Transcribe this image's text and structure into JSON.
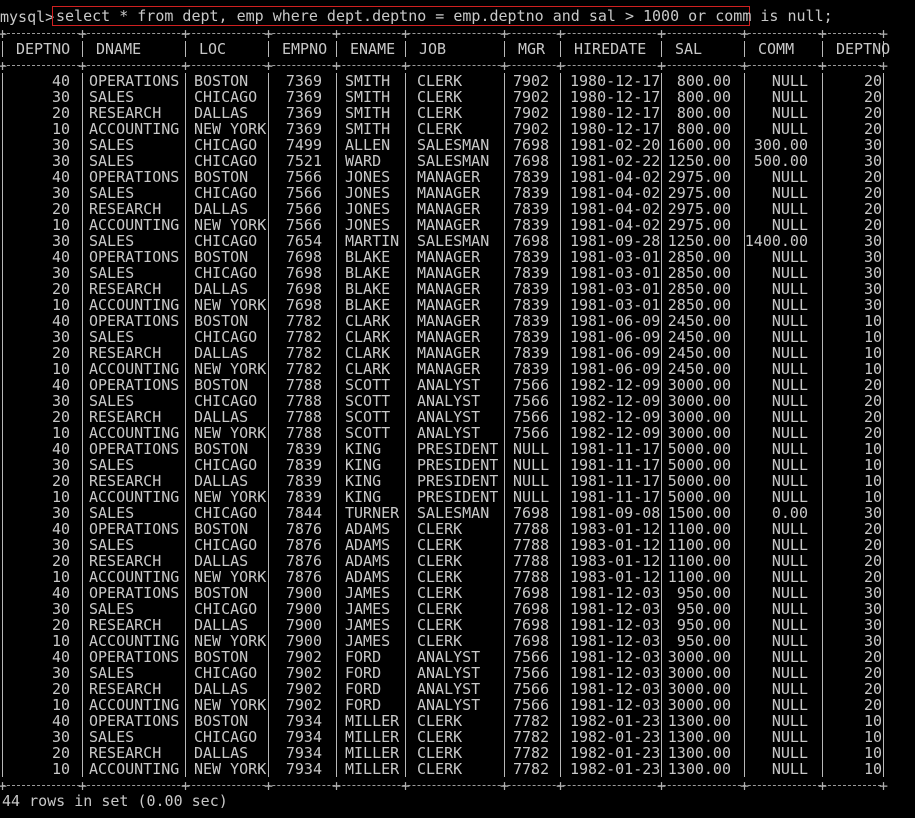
{
  "terminal": {
    "prompt": "mysql>",
    "query": "select * from dept, emp where dept.deptno = emp.deptno and sal > 1000 or comm is null;",
    "footer": "44 rows in set (0.00 sec)",
    "colors": {
      "background": "#000000",
      "text": "#c8c8c8",
      "highlight_box": "#d02020"
    }
  },
  "columns": [
    "DEPTNO",
    "DNAME",
    "LOC",
    "EMPNO",
    "ENAME",
    "JOB",
    "MGR",
    "HIREDATE",
    "SAL",
    "COMM",
    "DEPTNO"
  ],
  "rows": [
    [
      "40",
      "OPERATIONS",
      "BOSTON",
      "7369",
      "SMITH",
      "CLERK",
      "7902",
      "1980-12-17",
      "800.00",
      "NULL",
      "20"
    ],
    [
      "30",
      "SALES",
      "CHICAGO",
      "7369",
      "SMITH",
      "CLERK",
      "7902",
      "1980-12-17",
      "800.00",
      "NULL",
      "20"
    ],
    [
      "20",
      "RESEARCH",
      "DALLAS",
      "7369",
      "SMITH",
      "CLERK",
      "7902",
      "1980-12-17",
      "800.00",
      "NULL",
      "20"
    ],
    [
      "10",
      "ACCOUNTING",
      "NEW YORK",
      "7369",
      "SMITH",
      "CLERK",
      "7902",
      "1980-12-17",
      "800.00",
      "NULL",
      "20"
    ],
    [
      "30",
      "SALES",
      "CHICAGO",
      "7499",
      "ALLEN",
      "SALESMAN",
      "7698",
      "1981-02-20",
      "1600.00",
      "300.00",
      "30"
    ],
    [
      "30",
      "SALES",
      "CHICAGO",
      "7521",
      "WARD",
      "SALESMAN",
      "7698",
      "1981-02-22",
      "1250.00",
      "500.00",
      "30"
    ],
    [
      "40",
      "OPERATIONS",
      "BOSTON",
      "7566",
      "JONES",
      "MANAGER",
      "7839",
      "1981-04-02",
      "2975.00",
      "NULL",
      "20"
    ],
    [
      "30",
      "SALES",
      "CHICAGO",
      "7566",
      "JONES",
      "MANAGER",
      "7839",
      "1981-04-02",
      "2975.00",
      "NULL",
      "20"
    ],
    [
      "20",
      "RESEARCH",
      "DALLAS",
      "7566",
      "JONES",
      "MANAGER",
      "7839",
      "1981-04-02",
      "2975.00",
      "NULL",
      "20"
    ],
    [
      "10",
      "ACCOUNTING",
      "NEW YORK",
      "7566",
      "JONES",
      "MANAGER",
      "7839",
      "1981-04-02",
      "2975.00",
      "NULL",
      "20"
    ],
    [
      "30",
      "SALES",
      "CHICAGO",
      "7654",
      "MARTIN",
      "SALESMAN",
      "7698",
      "1981-09-28",
      "1250.00",
      "1400.00",
      "30"
    ],
    [
      "40",
      "OPERATIONS",
      "BOSTON",
      "7698",
      "BLAKE",
      "MANAGER",
      "7839",
      "1981-03-01",
      "2850.00",
      "NULL",
      "30"
    ],
    [
      "30",
      "SALES",
      "CHICAGO",
      "7698",
      "BLAKE",
      "MANAGER",
      "7839",
      "1981-03-01",
      "2850.00",
      "NULL",
      "30"
    ],
    [
      "20",
      "RESEARCH",
      "DALLAS",
      "7698",
      "BLAKE",
      "MANAGER",
      "7839",
      "1981-03-01",
      "2850.00",
      "NULL",
      "30"
    ],
    [
      "10",
      "ACCOUNTING",
      "NEW YORK",
      "7698",
      "BLAKE",
      "MANAGER",
      "7839",
      "1981-03-01",
      "2850.00",
      "NULL",
      "30"
    ],
    [
      "40",
      "OPERATIONS",
      "BOSTON",
      "7782",
      "CLARK",
      "MANAGER",
      "7839",
      "1981-06-09",
      "2450.00",
      "NULL",
      "10"
    ],
    [
      "30",
      "SALES",
      "CHICAGO",
      "7782",
      "CLARK",
      "MANAGER",
      "7839",
      "1981-06-09",
      "2450.00",
      "NULL",
      "10"
    ],
    [
      "20",
      "RESEARCH",
      "DALLAS",
      "7782",
      "CLARK",
      "MANAGER",
      "7839",
      "1981-06-09",
      "2450.00",
      "NULL",
      "10"
    ],
    [
      "10",
      "ACCOUNTING",
      "NEW YORK",
      "7782",
      "CLARK",
      "MANAGER",
      "7839",
      "1981-06-09",
      "2450.00",
      "NULL",
      "10"
    ],
    [
      "40",
      "OPERATIONS",
      "BOSTON",
      "7788",
      "SCOTT",
      "ANALYST",
      "7566",
      "1982-12-09",
      "3000.00",
      "NULL",
      "20"
    ],
    [
      "30",
      "SALES",
      "CHICAGO",
      "7788",
      "SCOTT",
      "ANALYST",
      "7566",
      "1982-12-09",
      "3000.00",
      "NULL",
      "20"
    ],
    [
      "20",
      "RESEARCH",
      "DALLAS",
      "7788",
      "SCOTT",
      "ANALYST",
      "7566",
      "1982-12-09",
      "3000.00",
      "NULL",
      "20"
    ],
    [
      "10",
      "ACCOUNTING",
      "NEW YORK",
      "7788",
      "SCOTT",
      "ANALYST",
      "7566",
      "1982-12-09",
      "3000.00",
      "NULL",
      "20"
    ],
    [
      "40",
      "OPERATIONS",
      "BOSTON",
      "7839",
      "KING",
      "PRESIDENT",
      "NULL",
      "1981-11-17",
      "5000.00",
      "NULL",
      "10"
    ],
    [
      "30",
      "SALES",
      "CHICAGO",
      "7839",
      "KING",
      "PRESIDENT",
      "NULL",
      "1981-11-17",
      "5000.00",
      "NULL",
      "10"
    ],
    [
      "20",
      "RESEARCH",
      "DALLAS",
      "7839",
      "KING",
      "PRESIDENT",
      "NULL",
      "1981-11-17",
      "5000.00",
      "NULL",
      "10"
    ],
    [
      "10",
      "ACCOUNTING",
      "NEW YORK",
      "7839",
      "KING",
      "PRESIDENT",
      "NULL",
      "1981-11-17",
      "5000.00",
      "NULL",
      "10"
    ],
    [
      "30",
      "SALES",
      "CHICAGO",
      "7844",
      "TURNER",
      "SALESMAN",
      "7698",
      "1981-09-08",
      "1500.00",
      "0.00",
      "30"
    ],
    [
      "40",
      "OPERATIONS",
      "BOSTON",
      "7876",
      "ADAMS",
      "CLERK",
      "7788",
      "1983-01-12",
      "1100.00",
      "NULL",
      "20"
    ],
    [
      "30",
      "SALES",
      "CHICAGO",
      "7876",
      "ADAMS",
      "CLERK",
      "7788",
      "1983-01-12",
      "1100.00",
      "NULL",
      "20"
    ],
    [
      "20",
      "RESEARCH",
      "DALLAS",
      "7876",
      "ADAMS",
      "CLERK",
      "7788",
      "1983-01-12",
      "1100.00",
      "NULL",
      "20"
    ],
    [
      "10",
      "ACCOUNTING",
      "NEW YORK",
      "7876",
      "ADAMS",
      "CLERK",
      "7788",
      "1983-01-12",
      "1100.00",
      "NULL",
      "20"
    ],
    [
      "40",
      "OPERATIONS",
      "BOSTON",
      "7900",
      "JAMES",
      "CLERK",
      "7698",
      "1981-12-03",
      "950.00",
      "NULL",
      "30"
    ],
    [
      "30",
      "SALES",
      "CHICAGO",
      "7900",
      "JAMES",
      "CLERK",
      "7698",
      "1981-12-03",
      "950.00",
      "NULL",
      "30"
    ],
    [
      "20",
      "RESEARCH",
      "DALLAS",
      "7900",
      "JAMES",
      "CLERK",
      "7698",
      "1981-12-03",
      "950.00",
      "NULL",
      "30"
    ],
    [
      "10",
      "ACCOUNTING",
      "NEW YORK",
      "7900",
      "JAMES",
      "CLERK",
      "7698",
      "1981-12-03",
      "950.00",
      "NULL",
      "30"
    ],
    [
      "40",
      "OPERATIONS",
      "BOSTON",
      "7902",
      "FORD",
      "ANALYST",
      "7566",
      "1981-12-03",
      "3000.00",
      "NULL",
      "20"
    ],
    [
      "30",
      "SALES",
      "CHICAGO",
      "7902",
      "FORD",
      "ANALYST",
      "7566",
      "1981-12-03",
      "3000.00",
      "NULL",
      "20"
    ],
    [
      "20",
      "RESEARCH",
      "DALLAS",
      "7902",
      "FORD",
      "ANALYST",
      "7566",
      "1981-12-03",
      "3000.00",
      "NULL",
      "20"
    ],
    [
      "10",
      "ACCOUNTING",
      "NEW YORK",
      "7902",
      "FORD",
      "ANALYST",
      "7566",
      "1981-12-03",
      "3000.00",
      "NULL",
      "20"
    ],
    [
      "40",
      "OPERATIONS",
      "BOSTON",
      "7934",
      "MILLER",
      "CLERK",
      "7782",
      "1982-01-23",
      "1300.00",
      "NULL",
      "10"
    ],
    [
      "30",
      "SALES",
      "CHICAGO",
      "7934",
      "MILLER",
      "CLERK",
      "7782",
      "1982-01-23",
      "1300.00",
      "NULL",
      "10"
    ],
    [
      "20",
      "RESEARCH",
      "DALLAS",
      "7934",
      "MILLER",
      "CLERK",
      "7782",
      "1982-01-23",
      "1300.00",
      "NULL",
      "10"
    ],
    [
      "10",
      "ACCOUNTING",
      "NEW YORK",
      "7934",
      "MILLER",
      "CLERK",
      "7782",
      "1982-01-23",
      "1300.00",
      "NULL",
      "10"
    ]
  ]
}
